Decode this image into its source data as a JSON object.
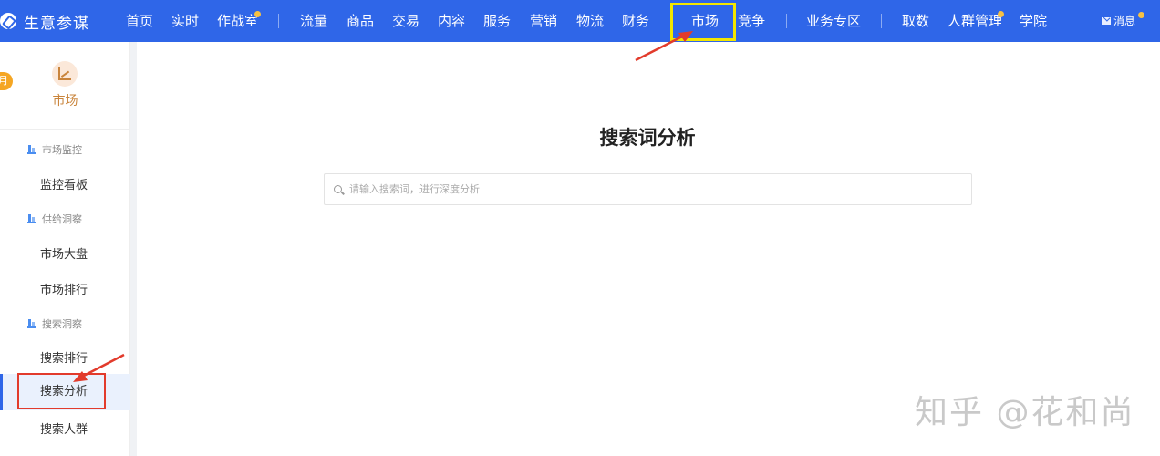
{
  "brand": {
    "name": "生意参谋"
  },
  "nav": {
    "items": [
      {
        "label": "首页"
      },
      {
        "label": "实时"
      },
      {
        "label": "作战室"
      },
      {
        "label": "流量"
      },
      {
        "label": "商品"
      },
      {
        "label": "交易"
      },
      {
        "label": "内容"
      },
      {
        "label": "服务"
      },
      {
        "label": "营销"
      },
      {
        "label": "物流"
      },
      {
        "label": "财务"
      },
      {
        "label": "市场"
      },
      {
        "label": "竞争"
      },
      {
        "label": "业务专区"
      },
      {
        "label": "取数"
      },
      {
        "label": "人群管理"
      },
      {
        "label": "学院"
      }
    ],
    "message_label": "消息",
    "active": "市场"
  },
  "sidebar": {
    "badge": "月",
    "title": "市场",
    "groups": [
      {
        "label": "市场监控",
        "items": [
          "监控看板"
        ]
      },
      {
        "label": "供给洞察",
        "items": [
          "市场大盘",
          "市场排行"
        ]
      },
      {
        "label": "搜索洞察",
        "items": [
          "搜索排行",
          "搜索分析",
          "搜索人群"
        ]
      }
    ],
    "active_item": "搜索分析"
  },
  "main": {
    "title": "搜索词分析",
    "search_placeholder": "请输入搜索词，进行深度分析"
  },
  "watermark": "知乎 @花和尚",
  "colors": {
    "nav_bg": "#2f66e8",
    "highlight_box": "#f2e600",
    "annotation_red": "#e23b2c",
    "market_accent": "#c9843b"
  }
}
